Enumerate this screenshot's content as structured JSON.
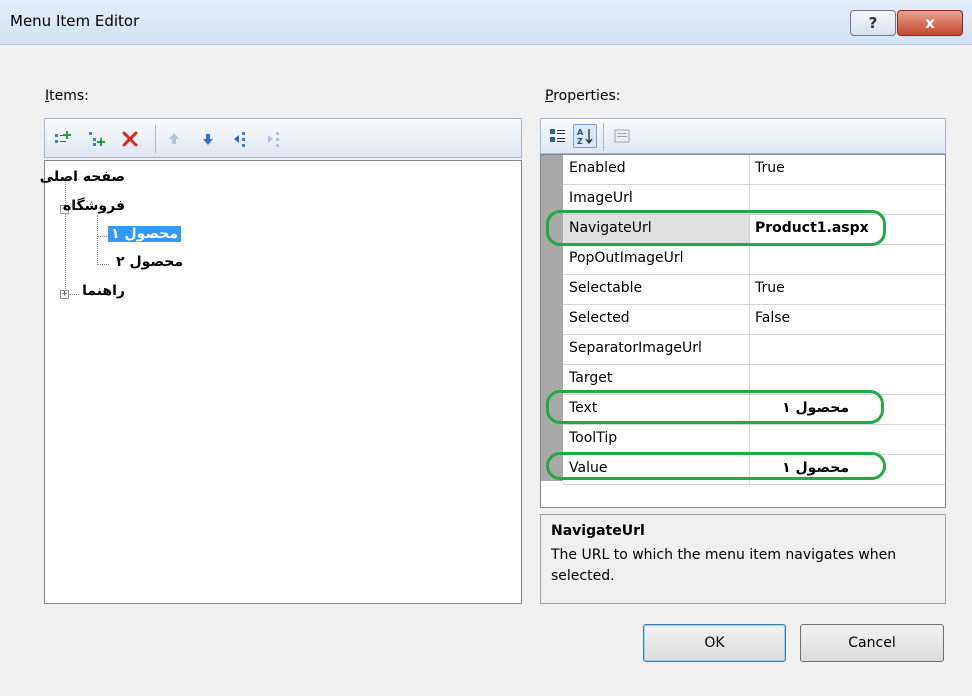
{
  "window": {
    "title": "Menu Item Editor",
    "help_glyph": "?",
    "close_glyph": "x"
  },
  "items_panel": {
    "label_accel": "I",
    "label_rest": "tems:",
    "toolbar_icons": [
      "add-root-item-icon",
      "add-child-item-icon",
      "delete-icon",
      "move-up-icon",
      "move-down-icon",
      "indent-icon",
      "outdent-icon"
    ],
    "tree": [
      {
        "text": "صفحه اصلی",
        "level": 0,
        "expander": ""
      },
      {
        "text": "فروشگاه",
        "level": 0,
        "expander": "−"
      },
      {
        "text": "محصول ۱",
        "level": 1,
        "expander": "",
        "selected": true
      },
      {
        "text": "محصول ۲",
        "level": 1,
        "expander": ""
      },
      {
        "text": "راهنما",
        "level": 0,
        "expander": "+"
      }
    ]
  },
  "properties_panel": {
    "label_accel": "P",
    "label_rest": "roperties:",
    "toolbar_icons": [
      "categorized-icon",
      "alphabetical-icon",
      "property-pages-icon"
    ],
    "rows": [
      {
        "name": "Enabled",
        "value": ""
      },
      {
        "name": "ImageUrl",
        "value": ""
      },
      {
        "name": "NavigateUrl",
        "value": "Product1.aspx",
        "bold": true,
        "selected": true
      },
      {
        "name": "PopOutImageUrl",
        "value": ""
      },
      {
        "name": "Selectable",
        "value": "True"
      },
      {
        "name": "Selected",
        "value": "False"
      },
      {
        "name": "SeparatorImageUrl",
        "value": ""
      },
      {
        "name": "Target",
        "value": ""
      },
      {
        "name": "Text",
        "value": "محصول ۱",
        "bold": true
      },
      {
        "name": "ToolTip",
        "value": ""
      },
      {
        "name": "Value",
        "value": "محصول ۱",
        "bold": true
      }
    ],
    "enabled_value": "True",
    "description": {
      "title": "NavigateUrl",
      "text": "The URL to which the menu item navigates when selected."
    }
  },
  "buttons": {
    "ok": "OK",
    "cancel": "Cancel"
  },
  "colors": {
    "highlight": "#22aa44",
    "selection": "#3399ff"
  }
}
